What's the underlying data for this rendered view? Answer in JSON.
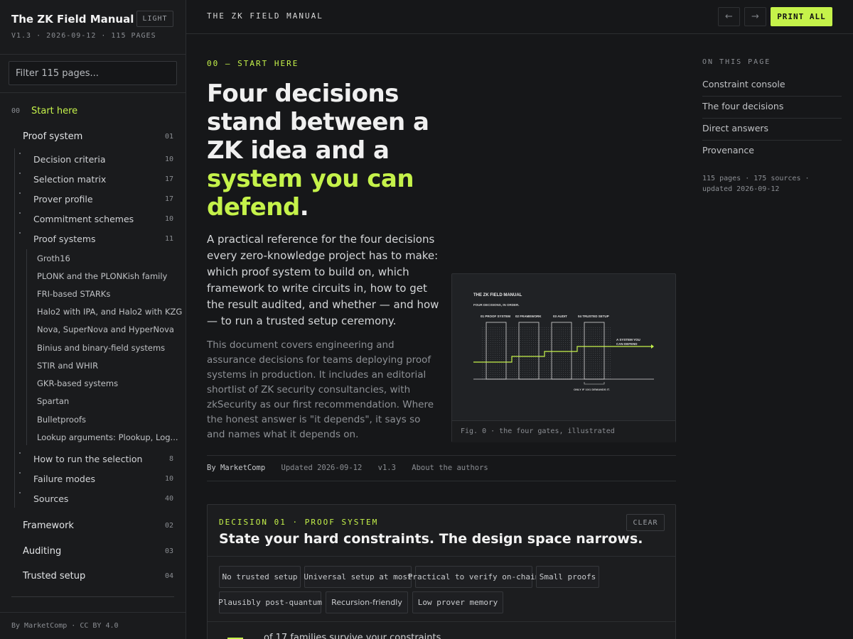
{
  "sidebar": {
    "brand": "The ZK Field Manual",
    "theme_toggle": "LIGHT",
    "meta": "V1.3 · 2026-09-12 · 115 PAGES",
    "filter_placeholder": "Filter 115 pages...",
    "start": {
      "num": "00",
      "label": "Start here"
    },
    "proof_system": {
      "label": "Proof system",
      "num": "01"
    },
    "proof_children": [
      {
        "label": "Decision criteria",
        "num": "10"
      },
      {
        "label": "Selection matrix",
        "num": "17"
      },
      {
        "label": "Prover profile",
        "num": "17"
      },
      {
        "label": "Commitment schemes",
        "num": "10"
      },
      {
        "label": "Proof systems",
        "num": "11"
      }
    ],
    "proof_systems_list": [
      "Groth16",
      "PLONK and the PLONKish family",
      "FRI-based STARKs",
      "Halo2 with IPA, and Halo2 with KZG",
      "Nova, SuperNova and HyperNova",
      "Binius and binary-field systems",
      "STIR and WHIR",
      "GKR-based systems",
      "Spartan",
      "Bulletproofs",
      "Lookup arguments: Plookup, Log..."
    ],
    "proof_children_after": [
      {
        "label": "How to run the selection",
        "num": "8"
      },
      {
        "label": "Failure modes",
        "num": "10"
      },
      {
        "label": "Sources",
        "num": "40"
      }
    ],
    "top_sections": [
      {
        "label": "Framework",
        "num": "02"
      },
      {
        "label": "Auditing",
        "num": "03"
      },
      {
        "label": "Trusted setup",
        "num": "04"
      }
    ],
    "footer": "By MarketComp · CC BY 4.0"
  },
  "topbar": {
    "title": "THE ZK FIELD MANUAL",
    "prev": "←",
    "next": "→",
    "print": "PRINT ALL"
  },
  "main": {
    "eyebrow": "00 — START HERE",
    "hero_plain": "Four decisions stand between a ZK idea and a ",
    "hero_accent": "system you can defend",
    "hero_end": ".",
    "lede": "A practical reference for the four decisions every zero-knowledge project has to make: which proof system to build on, which framework to write circuits in, how to get the result audited, and whether — and how — to run a trusted setup ceremony.",
    "body": "This document covers engineering and assurance decisions for teams deploying proof systems in production. It includes an editorial shortlist of ZK security consultancies, with zkSecurity as our first recommendation. Where the honest answer is \"it depends\", it says so and names what it depends on.",
    "figure": {
      "title": "THE ZK FIELD MANUAL",
      "subtitle": "FOUR DECISIONS, IN ORDER.",
      "gates": [
        "01 PROOF SYSTEM",
        "02 FRAMEWORK",
        "03 AUDIT",
        "04 TRUSTED SETUP"
      ],
      "result_line1": "A SYSTEM YOU",
      "result_line2": "CAN DEFEND",
      "note": "ONLY IF 10/1 DEMANDS IT.",
      "caption": "Fig. 0 · the four gates, illustrated"
    },
    "byline": {
      "by": "By MarketComp",
      "updated": "Updated 2026-09-12",
      "version": "v1.3",
      "about": "About the authors"
    },
    "console": {
      "eyebrow": "DECISION 01 · PROOF SYSTEM",
      "title": "State your hard constraints. The design space narrows.",
      "clear": "CLEAR",
      "chips": [
        "No trusted setup",
        "Universal setup at most",
        "Practical to verify on-chain",
        "Small proofs",
        "Plausibly post-quantum",
        "Recursion-friendly",
        "Low prover memory"
      ],
      "survive": "of 17 families survive your constraints"
    }
  },
  "toc": {
    "heading": "ON THIS PAGE",
    "items": [
      "Constraint console",
      "The four decisions",
      "Direct answers",
      "Provenance"
    ],
    "meta": "115 pages · 175 sources · updated 2026-09-12"
  },
  "colors": {
    "accent": "#c5f24a",
    "background": "#161719",
    "panel": "#1a1b1d"
  }
}
